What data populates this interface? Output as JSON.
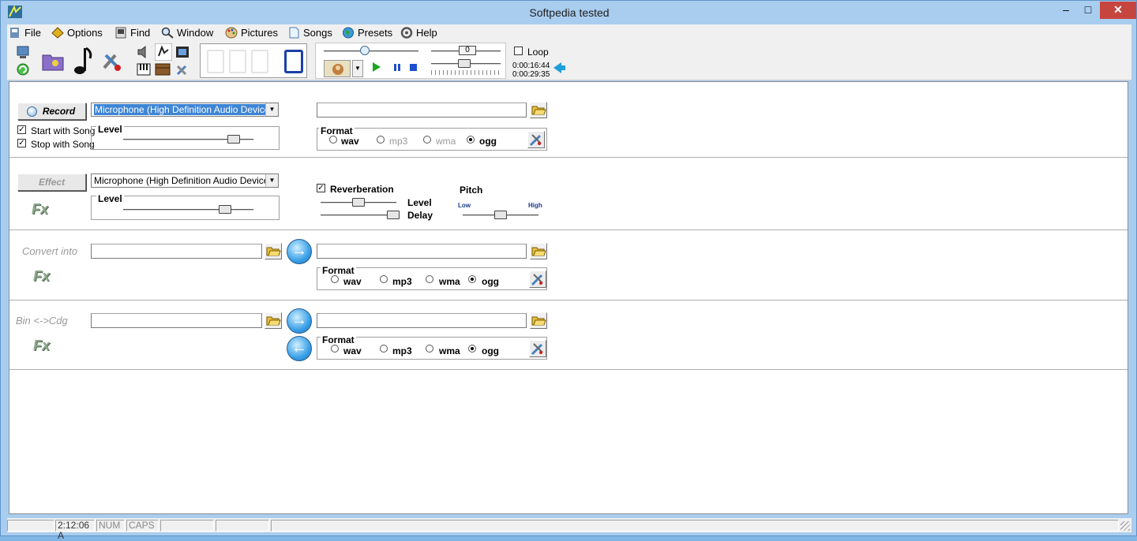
{
  "window": {
    "title": "Softpedia tested"
  },
  "menu": [
    "File",
    "Options",
    "Find",
    "Window",
    "Pictures",
    "Songs",
    "Presets",
    "Help"
  ],
  "toolbar": {
    "loop_label": "Loop",
    "time_elapsed": "0:00:16:44",
    "time_total": "0:00:29:35",
    "display_value": "0",
    "slider_value": "0"
  },
  "record": {
    "button": "Record",
    "device": "Microphone (High Definition Audio Device)",
    "start_with_song": "Start with Song",
    "stop_with_song": "Stop with Song",
    "level_label": "Level",
    "level_value": 0.85,
    "format_label": "Format",
    "formats": [
      "wav",
      "mp3",
      "wma",
      "ogg"
    ],
    "selected_format": "ogg"
  },
  "effect": {
    "button": "Effect",
    "device": "Microphone (High Definition Audio Device)",
    "level_label": "Level",
    "level_value": 0.78,
    "reverberation": "Reverberation",
    "reverb_level_label": "Level",
    "reverb_delay_label": "Delay",
    "pitch_label": "Pitch",
    "pitch_low": "Low",
    "pitch_high": "High",
    "logo": "Fx"
  },
  "convert": {
    "label": "Convert into",
    "format_label": "Format",
    "formats": [
      "wav",
      "mp3",
      "wma",
      "ogg"
    ],
    "selected_format": "ogg",
    "logo": "Fx"
  },
  "bincdg": {
    "label": "Bin <->Cdg",
    "format_label": "Format",
    "formats": [
      "wav",
      "mp3",
      "wma",
      "ogg"
    ],
    "selected_format": "ogg",
    "logo": "Fx"
  },
  "status": {
    "time": "2:12:06 A",
    "num": "NUM",
    "caps": "CAPS"
  },
  "colors": {
    "selection": "#3e85d5",
    "close": "#c7453f",
    "frame": "#a9cdef",
    "arrow": "#1e9fd8"
  }
}
